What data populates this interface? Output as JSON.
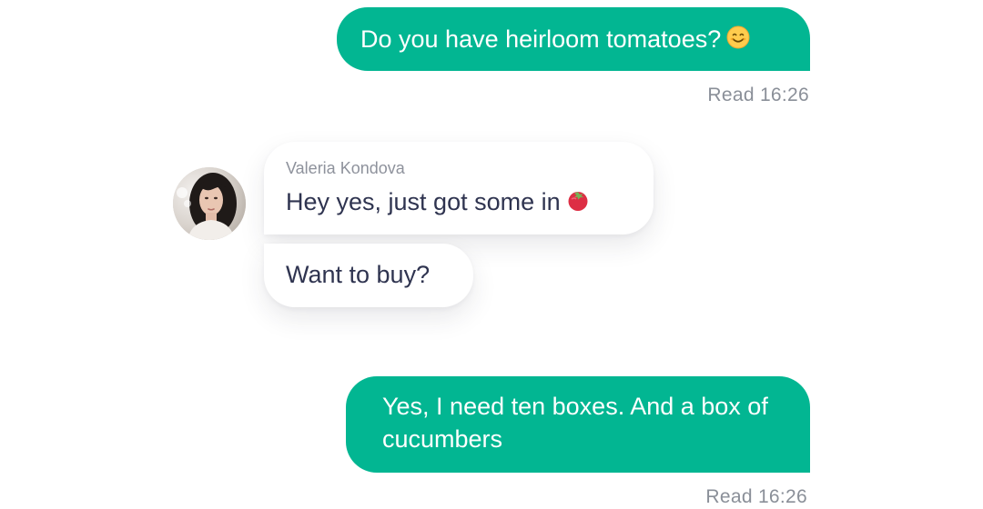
{
  "messages": [
    {
      "direction": "outgoing",
      "text": "Do you have heirloom tomatoes?",
      "emoji": "smiling-face-icon",
      "status": "Read 16:26"
    },
    {
      "direction": "incoming",
      "sender": "Valeria Kondova",
      "text": "Hey yes, just got some in",
      "emoji": "tomato-icon"
    },
    {
      "direction": "incoming",
      "text": "Want to buy?"
    },
    {
      "direction": "outgoing",
      "text": "Yes, I need ten boxes. And a box of cucumbers",
      "status": "Read 16:26"
    }
  ],
  "colors": {
    "outgoing_bubble": "#02b692",
    "incoming_text": "#2f3450",
    "status_text": "#8a8f98"
  }
}
